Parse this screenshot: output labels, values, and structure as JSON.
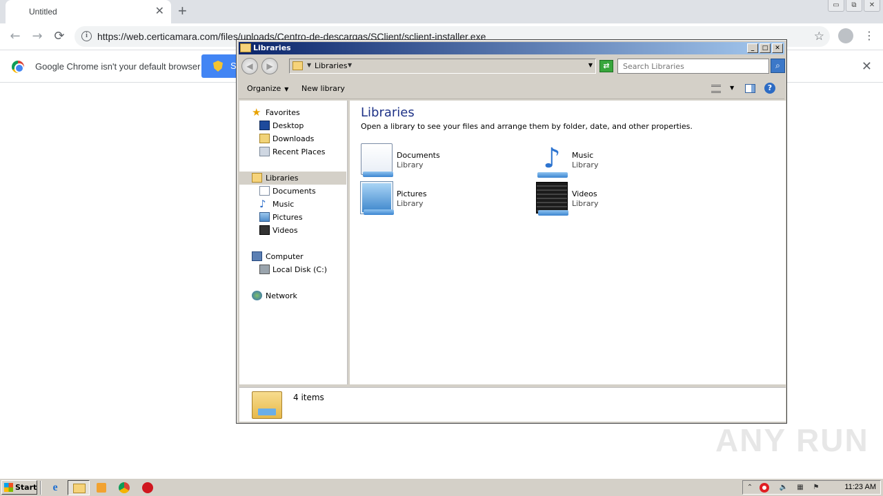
{
  "browser": {
    "tab_title": "Untitled",
    "tab_close": "✕",
    "new_tab": "+",
    "url": "https://web.certicamara.com/files/uploads/Centro-de-descargas/SClient/sclient-installer.exe",
    "back": "←",
    "forward": "→",
    "reload": "⟳",
    "bookmark_star": "☆",
    "menu_dots": "⋮",
    "window_controls": [
      "▭",
      "⧉",
      "✕"
    ],
    "infobar": {
      "message": "Google Chrome isn't your default browser",
      "button_label": "S",
      "close": "✕"
    }
  },
  "explorer": {
    "title": "Libraries",
    "title_buttons": [
      "_",
      "□",
      "✕"
    ],
    "back": "◀",
    "forward": "▶",
    "breadcrumb": "Libraries",
    "refresh": "⇄",
    "search_placeholder": "Search Libraries",
    "search_icon": "⌕",
    "commands": {
      "organize": "Organize",
      "new_library": "New library",
      "help": "?"
    },
    "nav": {
      "favorites": "Favorites",
      "desktop": "Desktop",
      "downloads": "Downloads",
      "recent_places": "Recent Places",
      "libraries": "Libraries",
      "documents": "Documents",
      "music": "Music",
      "pictures": "Pictures",
      "videos": "Videos",
      "computer": "Computer",
      "local_disk": "Local Disk (C:)",
      "network": "Network"
    },
    "content": {
      "heading": "Libraries",
      "subtitle": "Open a library to see your files and arrange them by folder, date, and other properties.",
      "libraries": [
        {
          "name": "Documents",
          "type": "Library",
          "icon": "documents-library-icon"
        },
        {
          "name": "Music",
          "type": "Library",
          "icon": "music-library-icon"
        },
        {
          "name": "Pictures",
          "type": "Library",
          "icon": "pictures-library-icon"
        },
        {
          "name": "Videos",
          "type": "Library",
          "icon": "videos-library-icon"
        }
      ]
    },
    "status": "4 items"
  },
  "watermark": "ANY RUN",
  "taskbar": {
    "start_label": "Start",
    "clock": "11:23 AM",
    "tray_chevron": "⌃"
  }
}
